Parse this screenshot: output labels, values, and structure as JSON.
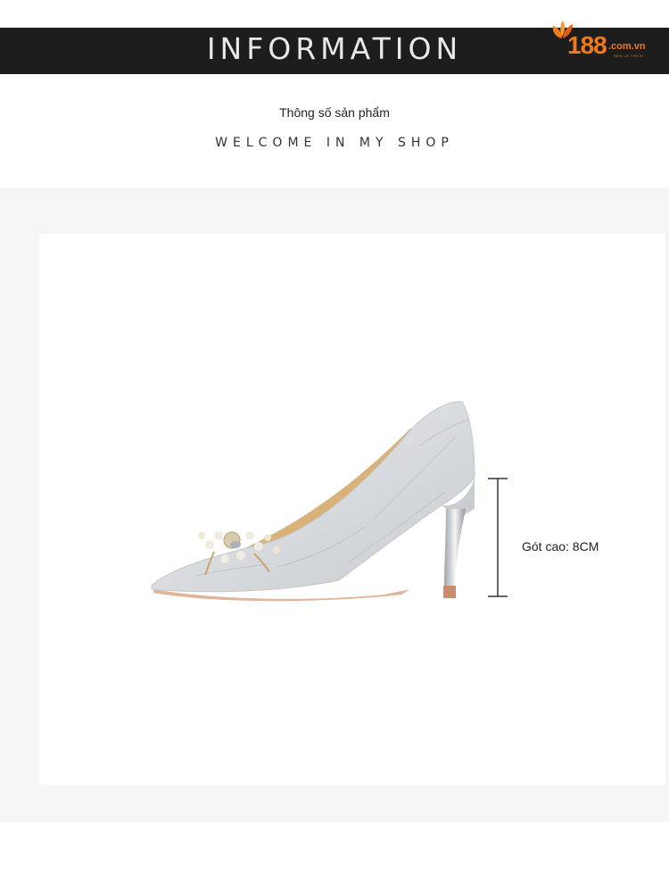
{
  "header": {
    "title": "INFORMATION",
    "logo": {
      "number": "188",
      "domain": ".com.vn",
      "tagline": "SEN LÀ THÍCH",
      "accent_color": "#f07a1a"
    }
  },
  "intro": {
    "subtitle": "Thông số sản phẩm",
    "welcome": "WELCOME IN MY SHOP"
  },
  "product": {
    "image": "silver-pointed-heel-pump-with-pearl-brooch",
    "heel_height_label": "Gót cao: 8CM"
  }
}
